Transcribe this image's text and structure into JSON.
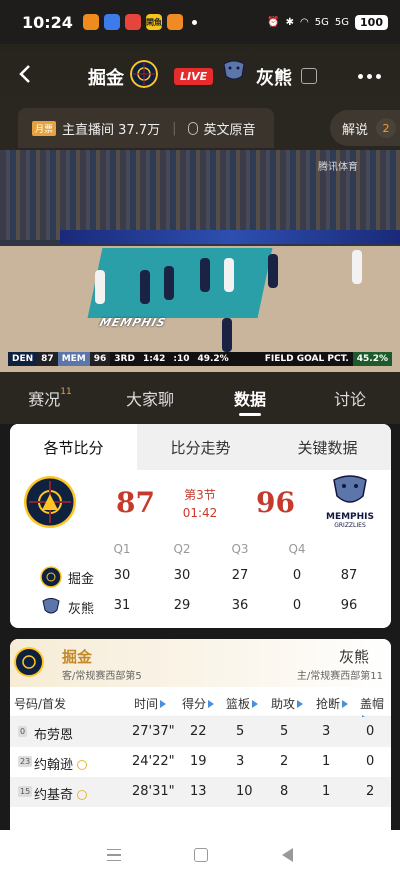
{
  "status_bar": {
    "time": "10:24",
    "apps": [
      {
        "icon": "weibo-app-icon",
        "label": "",
        "color": "#f08c1e"
      },
      {
        "icon": "app-blue-icon",
        "label": "",
        "color": "#3d7bea"
      },
      {
        "icon": "app-red-icon",
        "label": "",
        "color": "#e5453b"
      },
      {
        "icon": "app-yellow-icon",
        "label": "閑魚",
        "color": "#f5c518"
      },
      {
        "icon": "app-orange-icon",
        "label": "",
        "color": "#f08a24"
      }
    ],
    "signal_1": "5G",
    "signal_2": "5G",
    "battery": "100"
  },
  "header": {
    "home_team": "掘金",
    "live": "LIVE",
    "away_team": "灰熊"
  },
  "stream": {
    "badge": "月票",
    "anchor": "主直播间 37.7万",
    "audio": "英文原音",
    "commentary": "解说",
    "commentary_count": "2"
  },
  "video": {
    "watermark": "腾讯体育",
    "scorebug": {
      "away_abbr": "DEN",
      "away_score": "87",
      "home_abbr": "MEM",
      "home_score": "96",
      "period": "3RD",
      "clock": "1:42",
      "shot_clock": ":10",
      "den_pct": "49.2%",
      "label": "FIELD GOAL PCT.",
      "mem_pct": "45.2%"
    },
    "court_text": "MEMPHIS"
  },
  "main_tabs": [
    {
      "label": "赛况",
      "sup": "11"
    },
    {
      "label": "大家聊",
      "sup": ""
    },
    {
      "label": "数据",
      "sup": ""
    },
    {
      "label": "讨论",
      "sup": ""
    }
  ],
  "score_card": {
    "sub_tabs": [
      "各节比分",
      "比分走势",
      "关键数据"
    ],
    "home_score": "87",
    "away_score": "96",
    "period": "第3节",
    "clock": "01:42",
    "away_logo_text": "MEMPHIS",
    "away_logo_sub": "GRIZZLIES",
    "quarters": [
      "Q1",
      "Q2",
      "Q3",
      "Q4"
    ],
    "rows": [
      {
        "team": "掘金",
        "q": [
          "30",
          "30",
          "27",
          "0"
        ],
        "total": "87"
      },
      {
        "team": "灰熊",
        "q": [
          "31",
          "29",
          "36",
          "0"
        ],
        "total": "96"
      }
    ]
  },
  "player_stats": {
    "team": "掘金",
    "team_sub": "客/常规赛西部第5",
    "opp": "灰熊",
    "opp_sub": "主/常规赛西部第11",
    "columns": [
      "号码/首发",
      "时间",
      "得分",
      "篮板",
      "助攻",
      "抢断",
      "盖帽"
    ],
    "players": [
      {
        "num": "0",
        "name": "布劳恩",
        "star": false,
        "time": "27'37\"",
        "pts": "22",
        "reb": "5",
        "ast": "5",
        "stl": "3",
        "blk": "0"
      },
      {
        "num": "23",
        "name": "约翰逊",
        "star": true,
        "time": "24'22\"",
        "pts": "19",
        "reb": "3",
        "ast": "2",
        "stl": "1",
        "blk": "0"
      },
      {
        "num": "15",
        "name": "约基奇",
        "star": true,
        "time": "28'31\"",
        "pts": "13",
        "reb": "10",
        "ast": "8",
        "stl": "1",
        "blk": "2"
      }
    ]
  },
  "colors": {
    "accent": "#c43b2e",
    "gold": "#e6a23c",
    "header_bg": "#2a2620"
  }
}
